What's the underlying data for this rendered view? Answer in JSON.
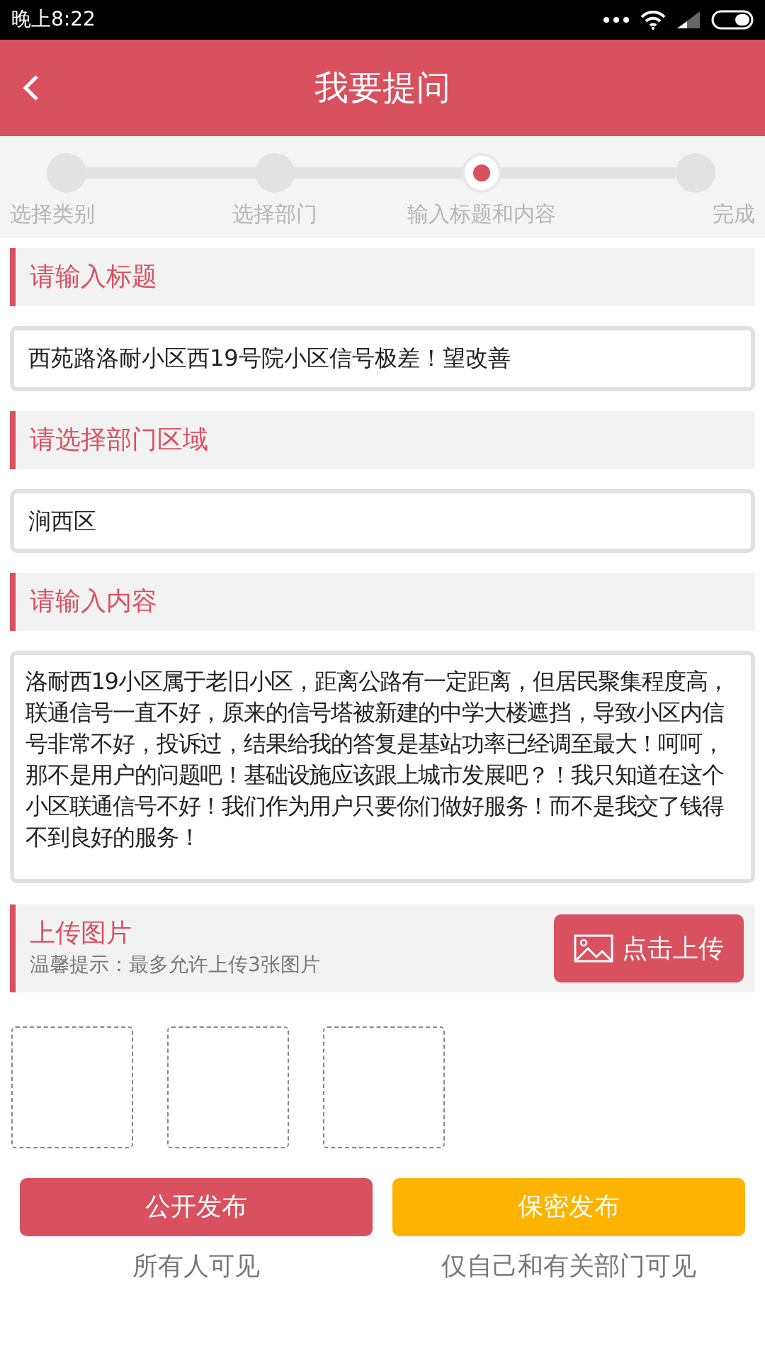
{
  "status_bar": {
    "time": "晚上8:22"
  },
  "header": {
    "title": "我要提问"
  },
  "steps": [
    {
      "label": "选择类别",
      "current": false
    },
    {
      "label": "选择部门",
      "current": false
    },
    {
      "label": "输入标题和内容",
      "current": true
    },
    {
      "label": "完成",
      "current": false
    }
  ],
  "title_section": {
    "heading": "请输入标题",
    "value": "西苑路洛耐小区西19号院小区信号极差！望改善"
  },
  "department_section": {
    "heading": "请选择部门区域",
    "value": "涧西区"
  },
  "content_section": {
    "heading": "请输入内容",
    "value": "洛耐西19小区属于老旧小区，距离公路有一定距离，但居民聚集程度高，联通信号一直不好，原来的信号塔被新建的中学大楼遮挡，导致小区内信号非常不好，投诉过，结果给我的答复是基站功率已经调至最大！呵呵，那不是用户的问题吧！基础设施应该跟上城市发展吧？！我只知道在这个小区联通信号不好！我们作为用户只要你们做好服务！而不是我交了钱得不到良好的服务！"
  },
  "upload_section": {
    "heading": "上传图片",
    "hint": "温馨提示：最多允许上传3张图片",
    "button": "点击上传",
    "slots": [
      {
        "kind": "empty"
      },
      {
        "kind": "empty"
      },
      {
        "kind": "empty"
      }
    ]
  },
  "actions": [
    {
      "label": "公开发布",
      "caption": "所有人可见",
      "kind": "public"
    },
    {
      "label": "保密发布",
      "caption": "仅自己和有关部门可见",
      "kind": "private"
    }
  ]
}
